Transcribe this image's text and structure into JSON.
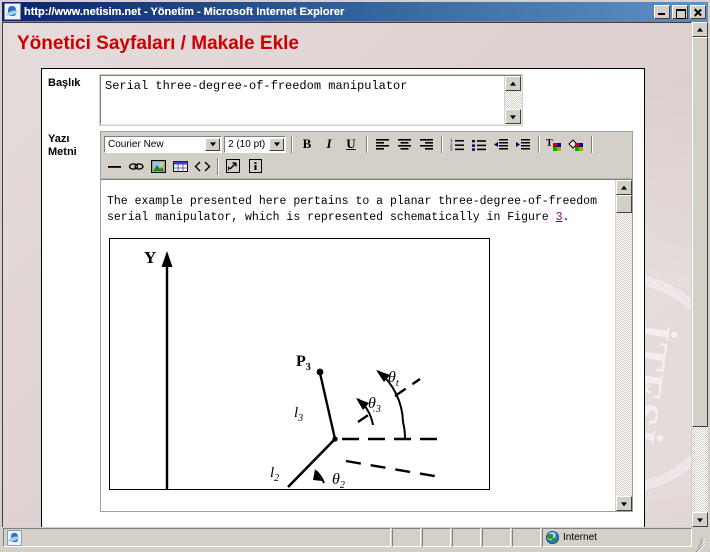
{
  "window": {
    "title": "http://www.netisim.net - Yönetim - Microsoft Internet Explorer",
    "icon": "ie-document-icon",
    "buttons": {
      "minimize": "_",
      "maximize": "□",
      "close": "✕"
    }
  },
  "page": {
    "heading": "Yönetici Sayfaları / Makale Ekle",
    "watermark": "İTESİ"
  },
  "form": {
    "title_label": "Başlık",
    "title_value": "Serial three-degree-of-freedom manipulator",
    "body_label_line1": "Yazı",
    "body_label_line2": "Metni"
  },
  "editor": {
    "font_family": "Courier New",
    "font_size": "2 (10 pt)",
    "buttons": {
      "bold": "B",
      "italic": "I",
      "underline": "U",
      "align_left": "align-left-icon",
      "align_center": "align-center-icon",
      "align_right": "align-right-icon",
      "ordered_list": "ordered-list-icon",
      "unordered_list": "unordered-list-icon",
      "outdent": "outdent-icon",
      "indent": "indent-icon",
      "text_color": "text-color-icon",
      "background_color": "background-color-icon",
      "horizontal_rule": "horizontal-rule-icon",
      "insert_link": "link-icon",
      "insert_image": "image-icon",
      "insert_table": "table-icon",
      "view_source": "html-source-icon",
      "popup_editor": "popup-editor-icon",
      "about": "info-icon"
    },
    "content": {
      "paragraph_part1": "The example presented here pertains to a planar three-degree-of-freedom serial manipulator, which is represented schematically in Figure ",
      "figure_link": "3",
      "paragraph_part2": "."
    },
    "figure": {
      "axis_label_y": "Y",
      "point_label": "P",
      "point_sub": "3",
      "link3_label": "l",
      "link3_sub": "3",
      "link2_label": "l",
      "link2_sub": "2",
      "theta_t": "θ",
      "theta_t_sub": "t",
      "theta_3": "θ",
      "theta_3_sub": "3",
      "theta_2": "θ",
      "theta_2_sub": "2"
    }
  },
  "statusbar": {
    "message": "",
    "zone": "Internet",
    "zone_icon": "globe-icon"
  },
  "colors": {
    "heading_red": "#cc0000",
    "titlebar_blue": "#0a246a",
    "link_purple": "#800080",
    "page_background": "#dccfcf",
    "chrome_gray": "#d4d0c8"
  }
}
